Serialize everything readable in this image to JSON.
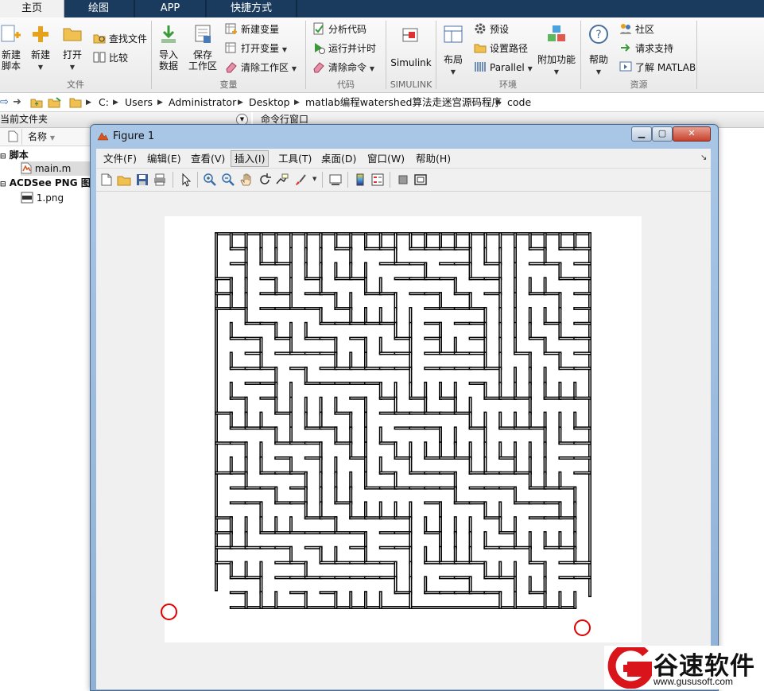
{
  "tabs": [
    {
      "label": "主页",
      "active": true
    },
    {
      "label": "绘图"
    },
    {
      "label": "APP"
    },
    {
      "label": "快捷方式"
    }
  ],
  "ribbon": {
    "file_group": {
      "label": "文件",
      "new_script": "新建\n脚本",
      "new": "新建",
      "open": "打开",
      "find_files": "查找文件",
      "compare": "比较"
    },
    "variable_group": {
      "label": "变量",
      "import_data": "导入\n数据",
      "save_workspace": "保存\n工作区",
      "new_variable": "新建变量",
      "open_variable": "打开变量",
      "clear_workspace": "清除工作区"
    },
    "code_group": {
      "label": "代码",
      "analyze_code": "分析代码",
      "run_and_time": "运行并计时",
      "clear_commands": "清除命令"
    },
    "simulink_group": {
      "label": "SIMULINK",
      "simulink": "Simulink"
    },
    "env_group": {
      "label": "环境",
      "layout": "布局",
      "preferences": "预设",
      "set_path": "设置路径",
      "parallel": "Parallel",
      "addons": "附加功能"
    },
    "resources_group": {
      "label": "资源",
      "help": "帮助",
      "community": "社区",
      "request_support": "请求支持",
      "learn_matlab": "了解 MATLAB"
    }
  },
  "address": {
    "crumbs": [
      "C:",
      "Users",
      "Administrator",
      "Desktop",
      "matlab编程watershed算法走迷宫源码程序",
      "code"
    ]
  },
  "current_folder": {
    "title": "当前文件夹",
    "col_name": "名称",
    "group1": "脚本",
    "file1": "main.m",
    "group2": "ACDSee PNG 图像",
    "file2": "1.png"
  },
  "command_window": {
    "title": "命令行窗口"
  },
  "figure": {
    "title": "Figure 1",
    "menus": [
      "文件(F)",
      "编辑(E)",
      "查看(V)",
      "插入(I)",
      "工具(T)",
      "桌面(D)",
      "窗口(W)",
      "帮助(H)"
    ],
    "selected_menu": "插入(I)",
    "toolbar_icons": [
      "new-figure-icon",
      "open-file-icon",
      "save-icon",
      "print-icon",
      "pointer-icon",
      "zoom-in-icon",
      "zoom-out-icon",
      "pan-icon",
      "rotate-icon",
      "data-cursor-icon",
      "brush-icon",
      "link-icon",
      "colorbar-icon",
      "legend-icon",
      "hide-tools-icon",
      "show-tools-icon"
    ],
    "marker_color": "#e00000"
  },
  "watermark": {
    "text": "谷速软件",
    "url": "www.gususoft.com",
    "color": "#d9141b"
  }
}
